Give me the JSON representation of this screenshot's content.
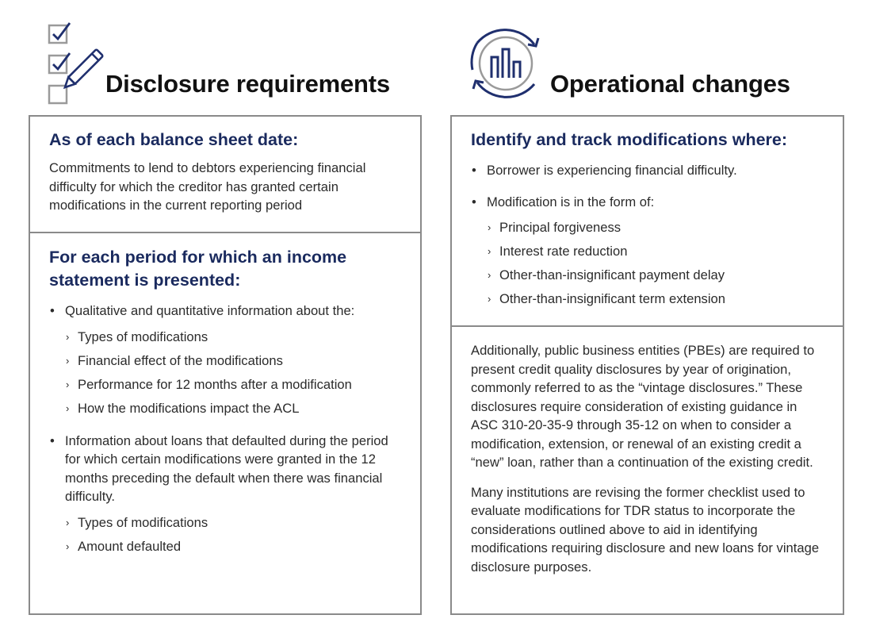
{
  "left": {
    "title": "Disclosure requirements",
    "icon": "checklist-pencil-icon",
    "sections": [
      {
        "heading": "As of each balance sheet date:",
        "body": "Commitments to lend to debtors experiencing financial difficulty for which the creditor has granted certain modifications in the current reporting period"
      },
      {
        "heading": "For each period for which an income statement is presented:",
        "bullets": [
          {
            "text": "Qualitative and quantitative information about the:",
            "sub": [
              "Types of modifications",
              "Financial effect of the modifications",
              "Performance for 12 months after a modification",
              "How the modifications impact the ACL"
            ]
          },
          {
            "text": "Information about loans that defaulted during the period for which certain modifications were granted in the 12 months preceding the default when there was financial difficulty.",
            "sub": [
              "Types of modifications",
              "Amount defaulted"
            ]
          }
        ]
      }
    ]
  },
  "right": {
    "title": "Operational changes",
    "icon": "cycle-bar-chart-icon",
    "sections": [
      {
        "heading": "Identify and track modifications where:",
        "bullets": [
          {
            "text": "Borrower is experiencing financial difficulty."
          },
          {
            "text": "Modification is in the form of:",
            "sub": [
              "Principal forgiveness",
              "Interest rate reduction",
              "Other-than-insignificant payment delay",
              "Other-than-insignificant term extension"
            ]
          }
        ]
      },
      {
        "paragraphs": [
          "Additionally, public business entities (PBEs) are required to present credit quality disclosures by year of origination, commonly referred to as the “vintage disclosures.” These disclosures require consideration of existing guidance in ASC 310-20-35-9 through 35-12 on when to consider a modification, extension, or renewal of an existing credit a “new” loan, rather than a continuation of the existing credit.",
          "Many institutions are revising the former checklist used to evaluate modifications for TDR status to incorporate the considerations outlined above to aid in identifying modifications requiring disclosure and new loans for vintage disclosure purposes."
        ]
      }
    ],
    "bullet_glyph": "•",
    "sub_glyph": "›"
  },
  "colors": {
    "heading": "#1a2a5e",
    "icon_navy": "#1f2f6e",
    "icon_gray": "#9a9a9a",
    "border": "#8a8a8a"
  }
}
